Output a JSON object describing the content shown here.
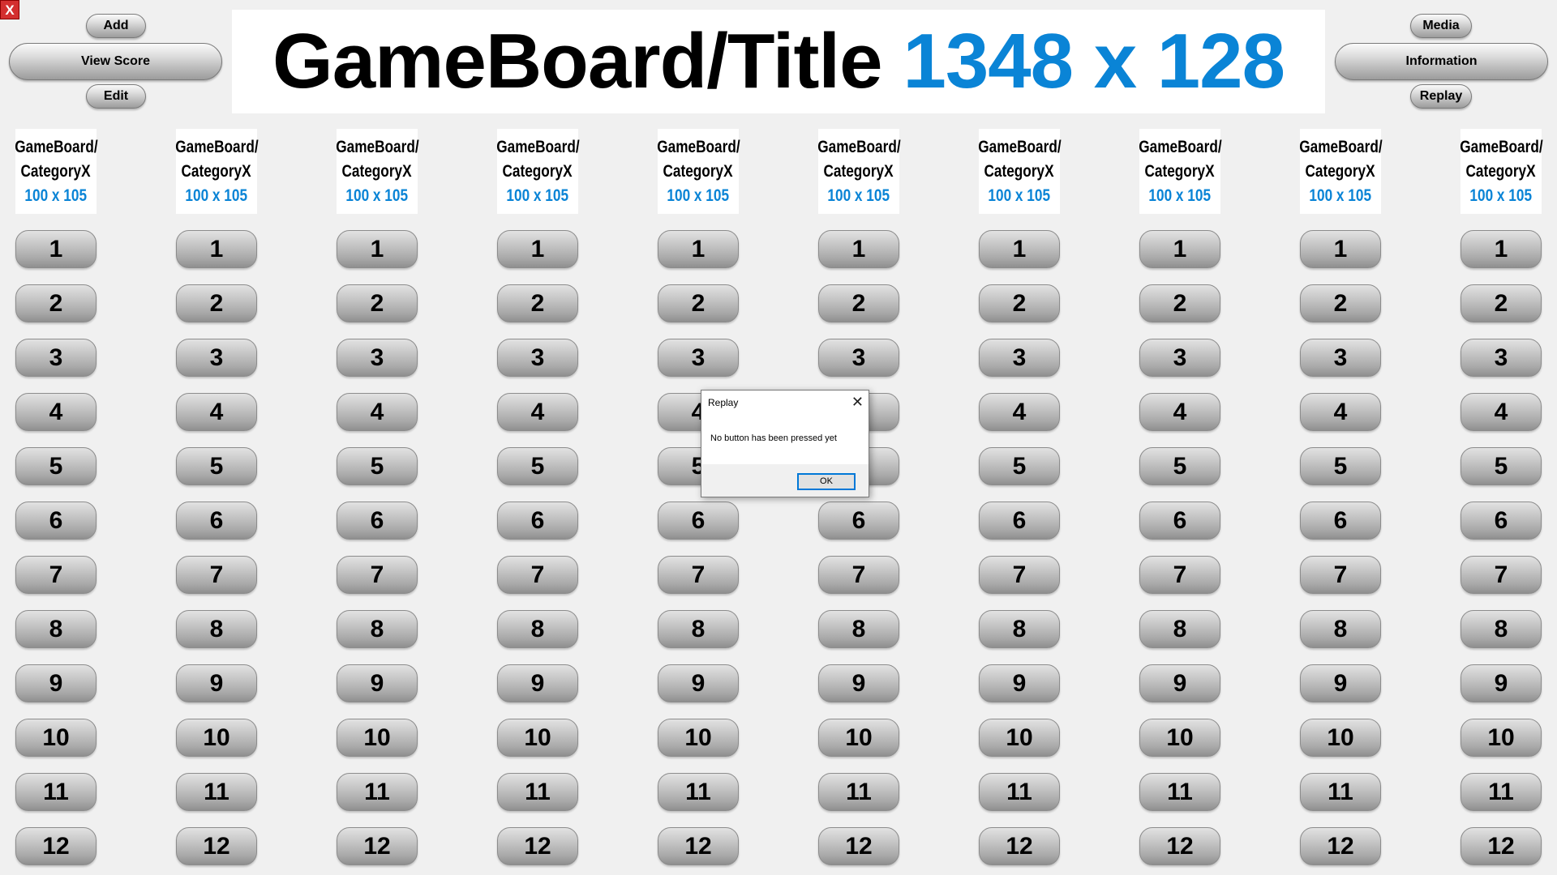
{
  "window": {
    "close_label": "X"
  },
  "left_buttons": {
    "add": "Add",
    "view_score": "View Score",
    "edit": "Edit"
  },
  "right_buttons": {
    "media": "Media",
    "information": "Information",
    "replay": "Replay"
  },
  "title": {
    "main": "GameBoard/Title",
    "size": "1348 x 128"
  },
  "category": {
    "line1": "GameBoard/",
    "line2": "CategoryX",
    "size": "100 x 105"
  },
  "columns": 10,
  "numbers": [
    "1",
    "2",
    "3",
    "4",
    "5",
    "6",
    "7",
    "8",
    "9",
    "10",
    "11",
    "12"
  ],
  "dialog": {
    "title": "Replay",
    "message": "No button has been pressed yet",
    "ok": "OK",
    "close_glyph": "✕"
  },
  "colors": {
    "accent_blue": "#0a84d6",
    "background": "#f0f0f0"
  }
}
